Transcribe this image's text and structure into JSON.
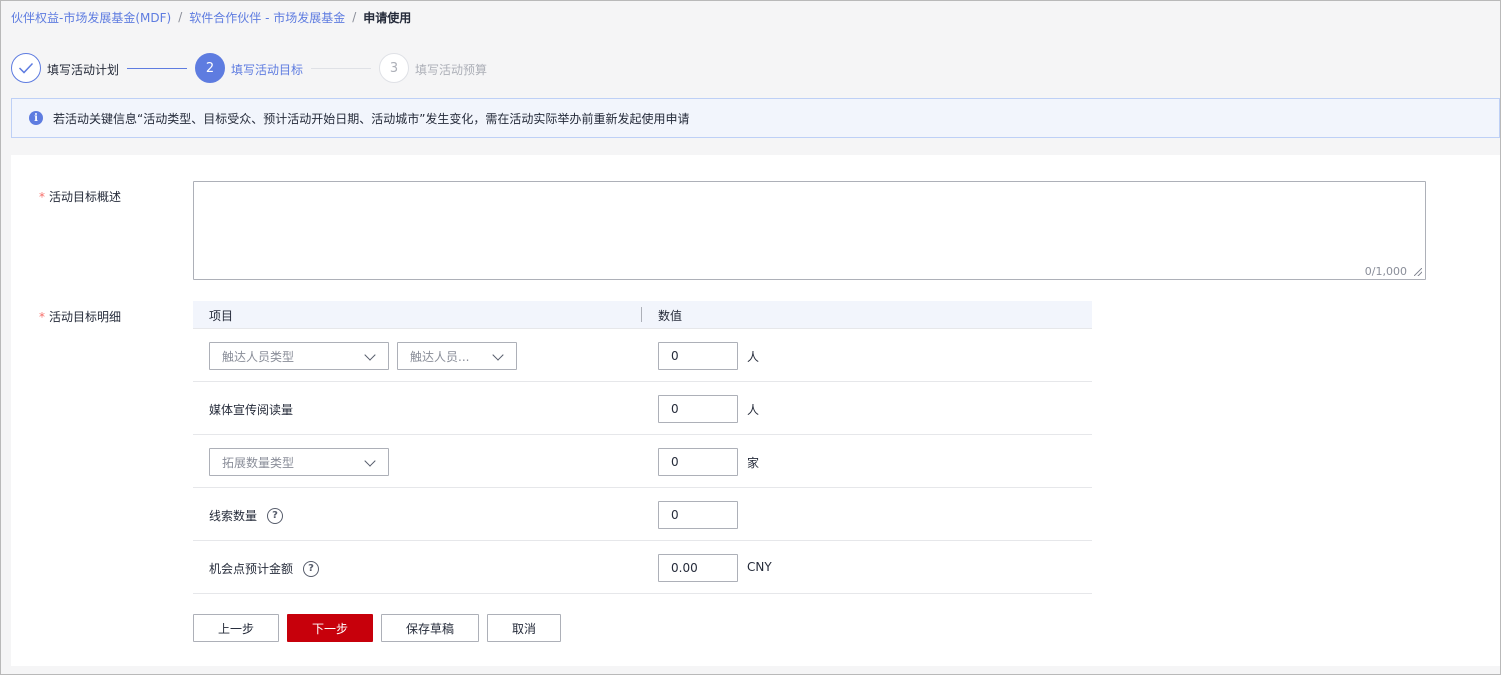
{
  "breadcrumb": {
    "items": [
      "伙伴权益-市场发展基金(MDF)",
      "软件合作伙伴 - 市场发展基金"
    ],
    "separator": "/",
    "current": "申请使用"
  },
  "steps": [
    {
      "number": "1",
      "label": "填写活动计划",
      "status": "done"
    },
    {
      "number": "2",
      "label": "填写活动目标",
      "status": "active"
    },
    {
      "number": "3",
      "label": "填写活动预算",
      "status": "pending"
    }
  ],
  "alert": {
    "icon": "info-icon",
    "text": "若活动关键信息“活动类型、目标受众、预计活动开始日期、活动城市”发生变化，需在活动实际举办前重新发起使用申请"
  },
  "form": {
    "required_mark": "*",
    "objective_label": "活动目标概述",
    "objective_value": "",
    "objective_counter": "0/1,000",
    "details_label": "活动目标明细"
  },
  "table": {
    "headers": {
      "item": "项目",
      "value": "数值"
    },
    "rows": [
      {
        "select1_placeholder": "触达人员类型",
        "select2_placeholder": "触达人员...",
        "value": "0",
        "unit": "人"
      },
      {
        "label": "媒体宣传阅读量",
        "value": "0",
        "unit": "人"
      },
      {
        "select1_placeholder": "拓展数量类型",
        "value": "0",
        "unit": "家"
      },
      {
        "label": "线索数量",
        "value": "0",
        "help": "?"
      },
      {
        "label": "机会点预计金额",
        "value": "0.00",
        "unit": "CNY",
        "help": "?"
      }
    ]
  },
  "buttons": {
    "prev": "上一步",
    "next": "下一步",
    "save_draft": "保存草稿",
    "cancel": "取消"
  },
  "colors": {
    "accent": "#5e7ce0",
    "primary_button": "#c7000b",
    "required": "#f66f6a"
  }
}
